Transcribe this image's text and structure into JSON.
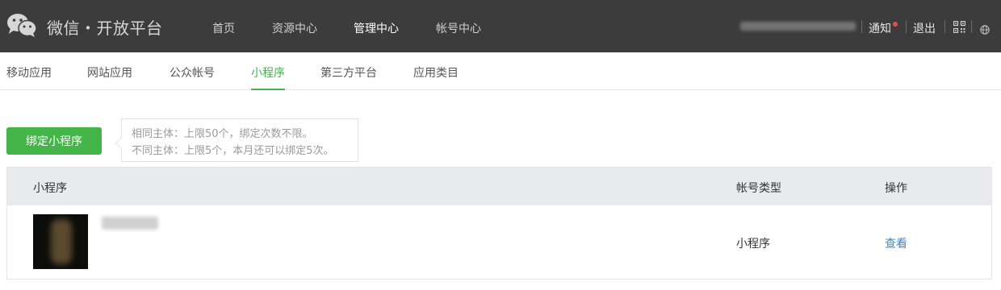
{
  "header": {
    "brand": "微信・开放平台",
    "nav": [
      {
        "label": "首页",
        "active": false
      },
      {
        "label": "资源中心",
        "active": false
      },
      {
        "label": "管理中心",
        "active": true
      },
      {
        "label": "帐号中心",
        "active": false
      }
    ],
    "notice_label": "通知",
    "logout_label": "退出",
    "icons": {
      "logo": "wechat-logo-icon",
      "qr": "qrcode-icon",
      "globe": "globe-icon"
    },
    "colors": {
      "bar": "#3c3c3c",
      "notice_dot": "#e0504a"
    }
  },
  "subnav": {
    "tabs": [
      {
        "label": "移动应用",
        "active": false
      },
      {
        "label": "网站应用",
        "active": false
      },
      {
        "label": "公众帐号",
        "active": false
      },
      {
        "label": "小程序",
        "active": true
      },
      {
        "label": "第三方平台",
        "active": false
      },
      {
        "label": "应用类目",
        "active": false
      }
    ],
    "active_color": "#44b549"
  },
  "actions": {
    "bind_label": "绑定小程序",
    "tip_line1": "相同主体：上限50个，绑定次数不限。",
    "tip_line2": "不同主体：上限5个，本月还可以绑定5次。"
  },
  "table": {
    "headers": {
      "app": "小程序",
      "type": "帐号类型",
      "action": "操作"
    },
    "rows": [
      {
        "type": "小程序",
        "action": "查看"
      }
    ]
  }
}
